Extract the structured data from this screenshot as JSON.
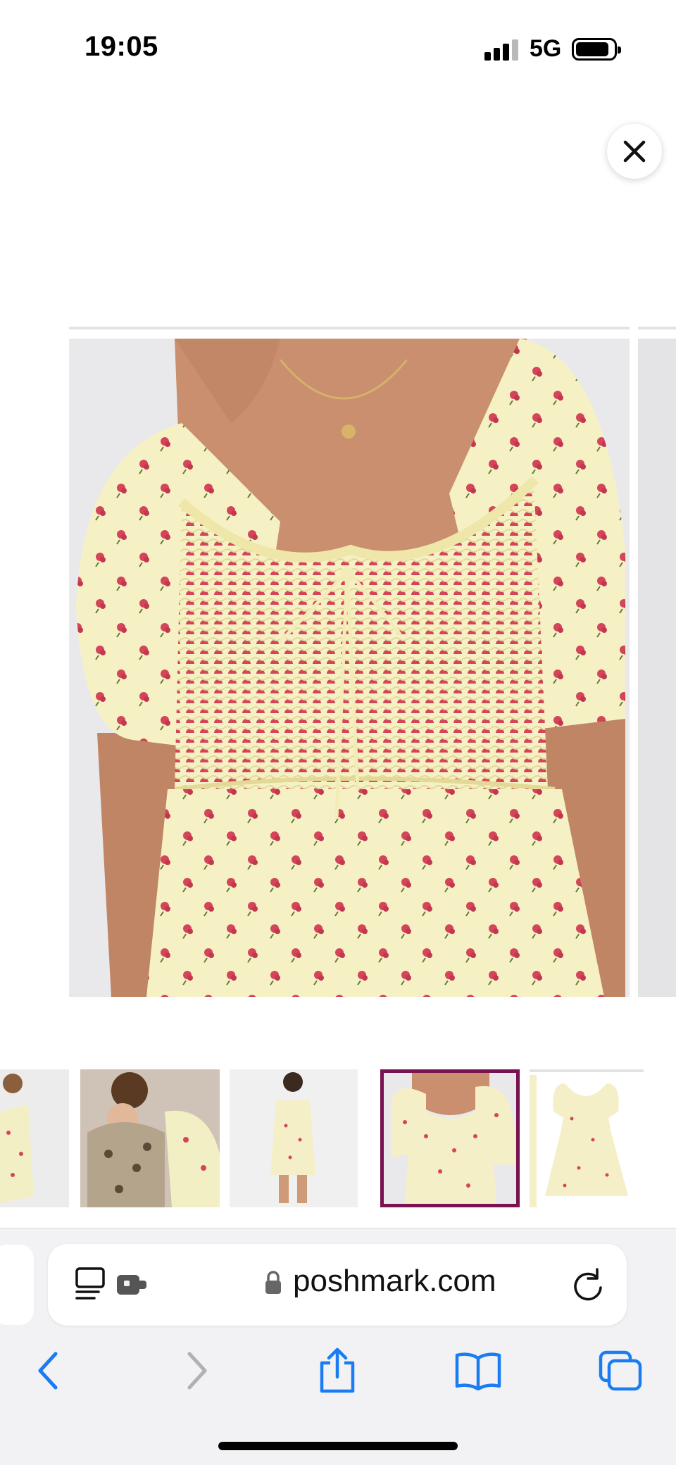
{
  "status_bar": {
    "time": "19:05",
    "network": "5G",
    "battery_icon": "battery-icon",
    "signal_icon": "signal-bars-icon"
  },
  "viewer": {
    "close_icon": "close-icon",
    "main_image_alt": "yellow floral smocked dress",
    "thumbnails_count": 5,
    "selected_thumbnail": 4
  },
  "browser": {
    "url": "poshmark.com",
    "lock_icon": "lock-icon",
    "reader_icon": "reader-mode-icon",
    "extension_icon": "extension-icon",
    "reload_icon": "reload-icon",
    "nav": {
      "back_icon": "back-chevron-icon",
      "forward_icon": "forward-chevron-icon",
      "share_icon": "share-icon",
      "bookmarks_icon": "bookmarks-book-icon",
      "tabs_icon": "tabs-icon"
    }
  },
  "colors": {
    "ios_blue": "#1a7cf2",
    "selected_thumb_border": "#7a1352",
    "dress_yellow": "#f5f0c0",
    "floral_red": "#d4455a"
  }
}
